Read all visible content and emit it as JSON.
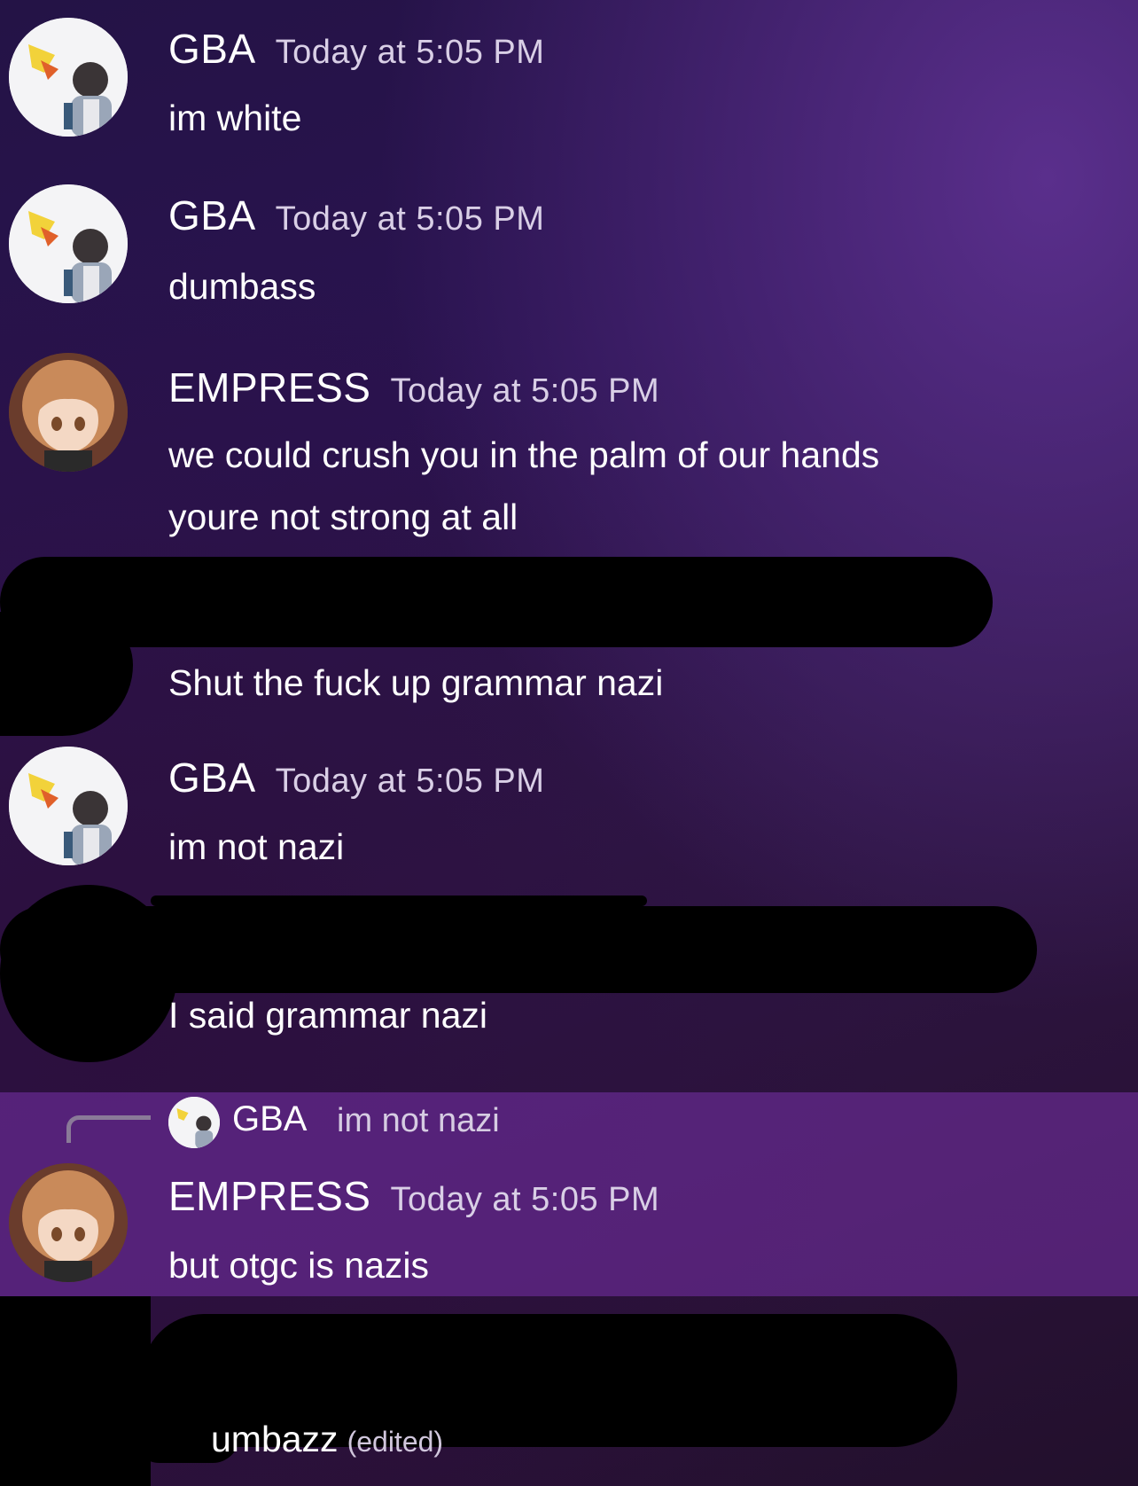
{
  "messages": [
    {
      "author": "GBA",
      "time": "Today at 5:05 PM",
      "lines": [
        "im white"
      ]
    },
    {
      "author": "GBA",
      "time": "Today at 5:05 PM",
      "lines": [
        "dumbass"
      ]
    },
    {
      "author": "EMPRESS",
      "time": "Today at 5:05 PM",
      "lines": [
        "we could crush you in the palm of our hands",
        "youre not strong at all"
      ]
    },
    {
      "author": "",
      "time": "",
      "lines": [
        "Shut the fuck up grammar nazi"
      ]
    },
    {
      "author": "GBA",
      "time": "Today at 5:05 PM",
      "lines": [
        "im not nazi"
      ]
    },
    {
      "author": "",
      "time": "",
      "lines": [
        "I said grammar nazi"
      ]
    },
    {
      "author": "EMPRESS",
      "time": "Today at 5:05 PM",
      "lines": [
        "but otgc is nazis"
      ],
      "reply": {
        "author": "GBA",
        "text": "im not nazi"
      }
    },
    {
      "author": "",
      "time": "",
      "lines": [
        "umbazz"
      ],
      "edited": "(edited)"
    }
  ],
  "icons": {
    "gba_avatar": "gba-avatar-icon",
    "empress_avatar": "empress-avatar-icon"
  },
  "colors": {
    "redaction": "#000000",
    "reply_highlight": "#7832aa",
    "timestamp": "#d9cfe6"
  }
}
